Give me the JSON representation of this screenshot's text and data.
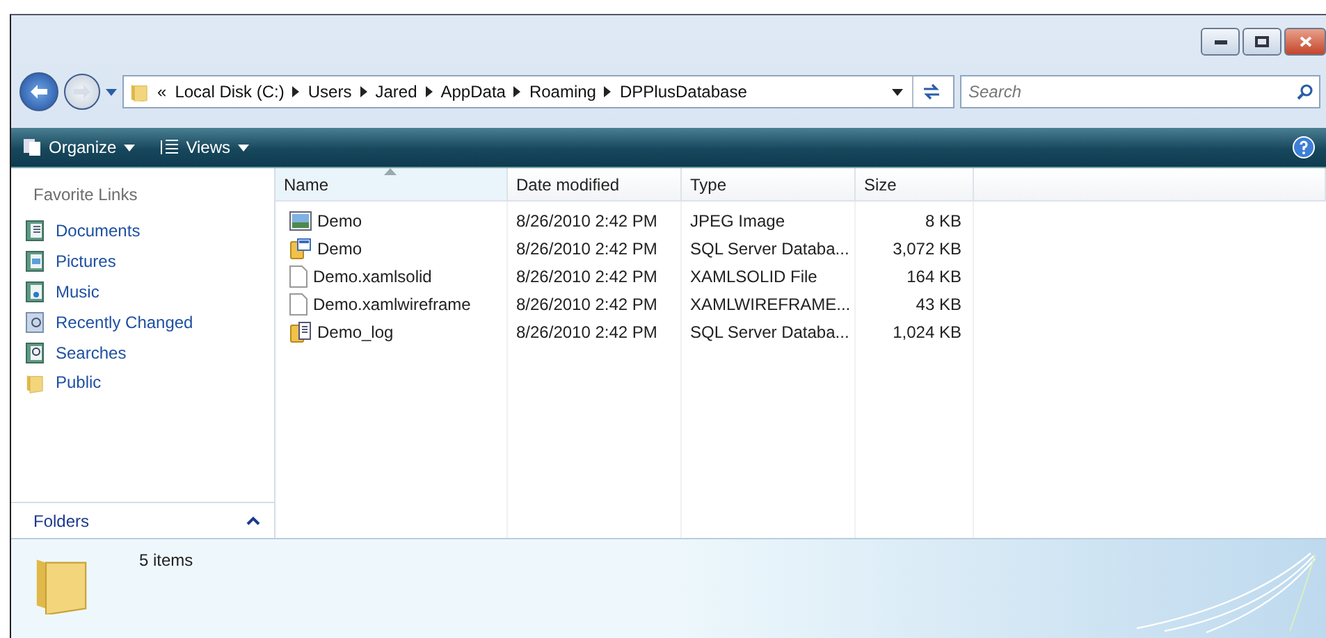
{
  "address": {
    "overflow": "«",
    "crumbs": [
      "Local Disk (C:)",
      "Users",
      "Jared",
      "AppData",
      "Roaming",
      "DPPlusDatabase"
    ]
  },
  "search": {
    "placeholder": "Search"
  },
  "toolbar": {
    "items": [
      {
        "label": "Organize",
        "kind": "organize"
      },
      {
        "label": "Views",
        "kind": "views"
      }
    ]
  },
  "sidebar": {
    "title": "Favorite Links",
    "items": [
      {
        "label": "Documents",
        "kind": "documents"
      },
      {
        "label": "Pictures",
        "kind": "pictures"
      },
      {
        "label": "Music",
        "kind": "music"
      },
      {
        "label": "Recently Changed",
        "kind": "recent"
      },
      {
        "label": "Searches",
        "kind": "searches"
      },
      {
        "label": "Public",
        "kind": "public"
      }
    ],
    "folders": {
      "label": "Folders",
      "expanded": false
    }
  },
  "table": {
    "columns": [
      {
        "label": "Name",
        "sorted": true
      },
      {
        "label": "Date modified",
        "sorted": false
      },
      {
        "label": "Type",
        "sorted": false
      },
      {
        "label": "Size",
        "sorted": false
      }
    ],
    "rows": [
      {
        "kind": "image",
        "name": "Demo",
        "date": "8/26/2010 2:42 PM",
        "type": "JPEG Image",
        "size": "8 KB"
      },
      {
        "kind": "database",
        "name": "Demo",
        "date": "8/26/2010 2:42 PM",
        "type": "SQL Server Databa...",
        "size": "3,072 KB"
      },
      {
        "kind": "file",
        "name": "Demo.xamlsolid",
        "date": "8/26/2010 2:42 PM",
        "type": "XAMLSOLID File",
        "size": "164 KB"
      },
      {
        "kind": "file",
        "name": "Demo.xamlwireframe",
        "date": "8/26/2010 2:42 PM",
        "type": "XAMLWIREFRAME...",
        "size": "43 KB"
      },
      {
        "kind": "log",
        "name": "Demo_log",
        "date": "8/26/2010 2:42 PM",
        "type": "SQL Server Databa...",
        "size": "1,024 KB"
      }
    ]
  },
  "status_bar": {
    "count": "5 items"
  }
}
